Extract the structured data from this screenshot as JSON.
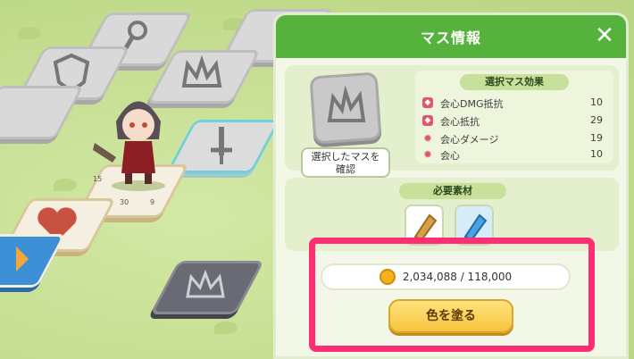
{
  "panel": {
    "title": "マス情報",
    "close_icon": "close-icon",
    "confirm_label": "選択したマスを\n確認",
    "effects_title": "選択マス効果",
    "effects": [
      {
        "label": "会心DMG抵抗",
        "value": "10",
        "icon": "shield-icon"
      },
      {
        "label": "会心抵抗",
        "value": "29",
        "icon": "shield-icon"
      },
      {
        "label": "会心ダメージ",
        "value": "19",
        "icon": "flame-icon"
      },
      {
        "label": "会心",
        "value": "10",
        "icon": "flame-icon"
      }
    ],
    "materials_title": "必要素材",
    "materials": [
      {
        "name": "gold-crystal-icon",
        "color": "#d6a04a"
      },
      {
        "name": "blue-crystal-icon",
        "color": "#4aa3e0"
      }
    ],
    "cost": "2,034,088 / 118,000",
    "paint_label": "色を塗る"
  },
  "board": {
    "labels": [
      "15",
      "30",
      "9"
    ]
  },
  "colors": {
    "header": "#55b23d",
    "highlight": "#ff2d73",
    "button": "#f6c43e"
  }
}
